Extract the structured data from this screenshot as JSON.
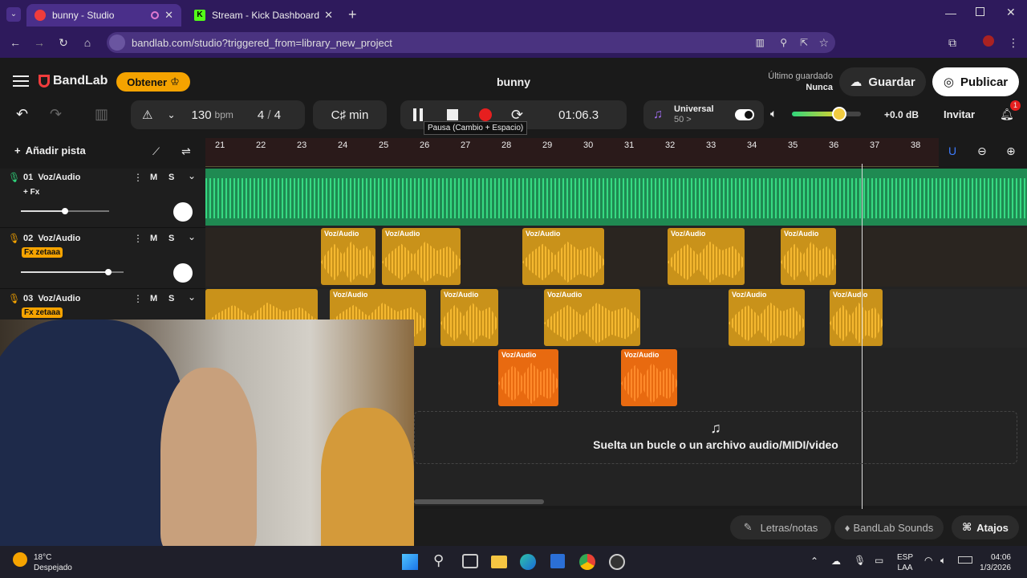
{
  "browser": {
    "tabs": [
      {
        "title": "bunny - Studio",
        "active": true
      },
      {
        "title": "Stream - Kick Dashboard",
        "active": false
      }
    ],
    "url": "bandlab.com/studio?triggered_from=library_new_project"
  },
  "app": {
    "brand": "BandLab",
    "get_button": "Obtener",
    "project_title": "bunny",
    "last_saved_label": "Último guardado",
    "last_saved_value": "Nunca",
    "save_button": "Guardar",
    "publish_button": "Publicar"
  },
  "toolbar": {
    "tempo": "130",
    "tempo_unit": "bpm",
    "time_sig_num": "4",
    "time_sig_sep": "/",
    "time_sig_den": "4",
    "key": "C♯ min",
    "time": "01:06.3",
    "tooltip": "Pausa (Cambio + Espacio)",
    "preset_name": "Universal",
    "preset_value": "50 >",
    "volume_db": "+0.0 dB",
    "volume_level": 0.62,
    "invite_button": "Invitar",
    "notif_count": "1"
  },
  "tracks_panel": {
    "add_track": "Añadir pista"
  },
  "ruler": [
    "21",
    "22",
    "23",
    "24",
    "25",
    "26",
    "27",
    "28",
    "29",
    "30",
    "31",
    "32",
    "33",
    "34",
    "35",
    "36",
    "37",
    "38"
  ],
  "tracks": [
    {
      "num": "01",
      "name": "Voz/Audio",
      "fx": "+ Fx",
      "m": "M",
      "s": "S",
      "volume": 0.5
    },
    {
      "num": "02",
      "name": "Voz/Audio",
      "fx": "Fx zetaaa",
      "m": "M",
      "s": "S",
      "volume": 0.85
    },
    {
      "num": "03",
      "name": "Voz/Audio",
      "fx": "Fx zetaaa",
      "m": "M",
      "s": "S"
    }
  ],
  "clip_label": "Voz/Audio",
  "drop_zone": "Suelta un bucle o un archivo audio/MIDI/video",
  "bottom": {
    "lyrics": "Letras/notas",
    "sounds": "BandLab Sounds",
    "shortcuts": "Atajos"
  },
  "taskbar": {
    "weather_temp": "18°C",
    "weather_desc": "Despejado",
    "lang1": "ESP",
    "lang2": "LAA",
    "clock_time": "04:06",
    "clock_date": "1/3/2026"
  },
  "colors": {
    "accent_orange": "#f5a300",
    "track1_green": "#2fd67c",
    "clip_yellow": "#c9921a",
    "clip_orange": "#e86a10",
    "record_red": "#e61f1f"
  }
}
